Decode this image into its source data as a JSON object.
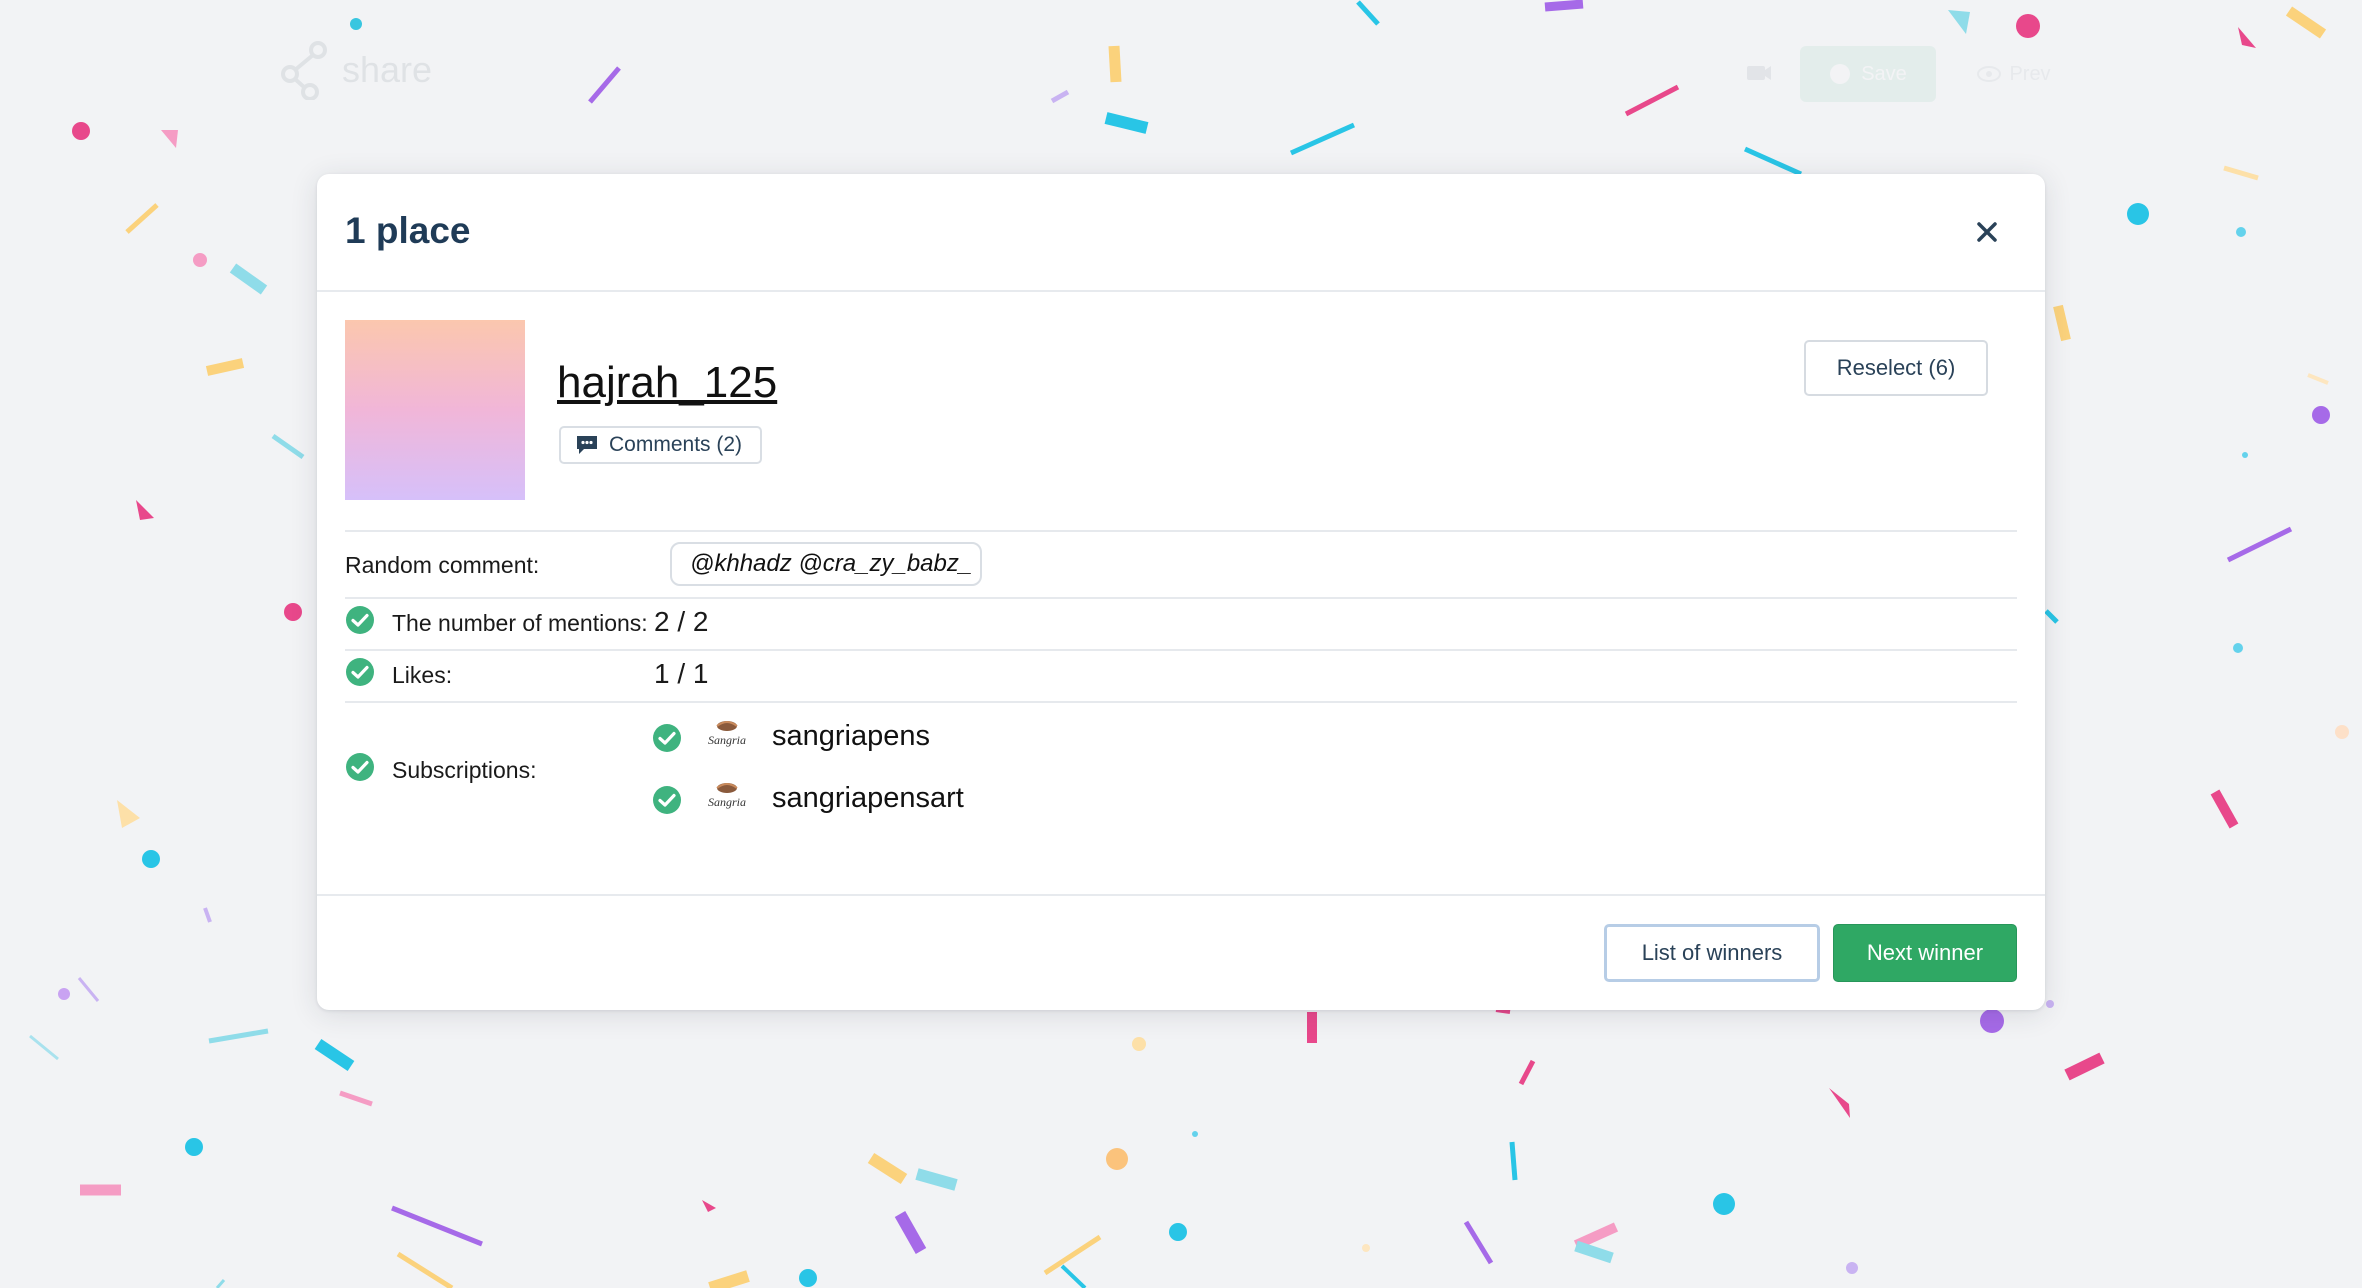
{
  "background": {
    "app_name": "share",
    "save_label": "Save",
    "preview_label": "Prev"
  },
  "modal": {
    "title": "1 place",
    "close_icon": "close-icon",
    "winner": {
      "username": "hajrah_125",
      "comments_label": "Comments (2)",
      "avatar_gradient": [
        "#fbc7ae",
        "#f1b6d8",
        "#d6c0fa"
      ]
    },
    "reselect_label": "Reselect (6)",
    "details": {
      "random_comment_label": "Random comment:",
      "random_comment_value": "@khhadz @cra_zy_babz_",
      "mentions_label": "The number of mentions:",
      "mentions_value": "2 / 2",
      "likes_label": "Likes:",
      "likes_value": "1 / 1",
      "subscriptions_label": "Subscriptions:",
      "subscriptions": [
        {
          "name": "sangriapens",
          "logo_text": "Sangria"
        },
        {
          "name": "sangriapensart",
          "logo_text": "Sangria"
        }
      ]
    },
    "footer": {
      "list_label": "List of winners",
      "next_label": "Next winner"
    }
  },
  "colors": {
    "accent_green": "#2fa864",
    "check_green": "#3fb37f",
    "title_navy": "#1f3b57"
  }
}
